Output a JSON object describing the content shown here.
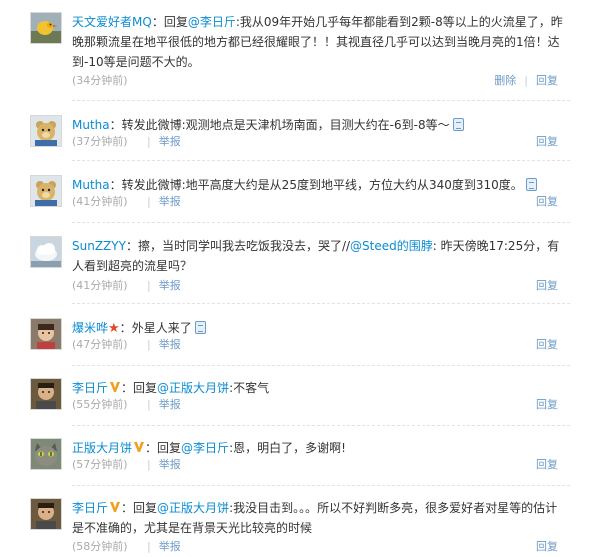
{
  "comments": [
    {
      "author": "天文爱好者MQ",
      "sep": "：",
      "prefix": "回复",
      "mention": "@李日斤",
      "text": ":我从09年开始几乎每年都能看到2颗-8等以上的火流星了，昨晚那颗流星在地平很低的地方都已经很耀眼了！！其视直径几乎可以达到当晚月亮的1倍！达到-10等是问题不大的。",
      "time": "(34分钟前)",
      "action_left": "删除",
      "action_right": "回复",
      "avatar_icon": "bird-avatar-icon"
    },
    {
      "author": "Mutha",
      "sep": "：",
      "text": "转发此微博:观测地点是天津机场南面，目测大约在-6到-8等～",
      "time": "(37分钟前)",
      "action_left": "举报",
      "action_right": "回复",
      "avatar_icon": "teddy-bear-avatar-icon"
    },
    {
      "author": "Mutha",
      "sep": "：",
      "text": "转发此微博:地平高度大约是从25度到地平线，方位大约从340度到310度。",
      "time": "(41分钟前)",
      "action_left": "举报",
      "action_right": "回复",
      "avatar_icon": "teddy-bear-avatar-icon"
    },
    {
      "author": "SunZZYY",
      "sep": "：",
      "text_a": "擦，当时同学叫我去吃饭我没去，哭了//",
      "mention": "@Steed的围脖",
      "text_b": ": 昨天傍晚17:25分，有人看到超亮的流星吗？",
      "time": "(41分钟前)",
      "action_left": "举报",
      "action_right": "回复",
      "avatar_icon": "cloud-avatar-icon"
    },
    {
      "author": "爆米哗",
      "sep": "：",
      "text": "外星人来了",
      "time": "(47分钟前)",
      "action_left": "举报",
      "action_right": "回复",
      "avatar_icon": "child-photo-avatar-icon"
    },
    {
      "author": "李日斤",
      "sep": "：",
      "prefix": "回复",
      "mention": "@正版大月饼",
      "text": ":不客气",
      "time": "(55分钟前)",
      "action_left": "举报",
      "action_right": "回复",
      "avatar_icon": "person-photo-avatar-icon"
    },
    {
      "author": "正版大月饼",
      "sep": "：",
      "prefix": "回复",
      "mention": "@李日斤",
      "text": ":恩，明白了，多谢啊!",
      "time": "(57分钟前)",
      "action_left": "举报",
      "action_right": "回复",
      "avatar_icon": "cat-avatar-icon"
    },
    {
      "author": "李日斤",
      "sep": "：",
      "prefix": "回复",
      "mention": "@正版大月饼",
      "text": ":我没目击到。。。所以不好判断多亮，很多爱好者对星等的估计是不准确的，尤其是在背景天光比较亮的时候",
      "time": "(58分钟前)",
      "action_left": "举报",
      "action_right": "回复",
      "avatar_icon": "person-photo-avatar-icon"
    }
  ]
}
